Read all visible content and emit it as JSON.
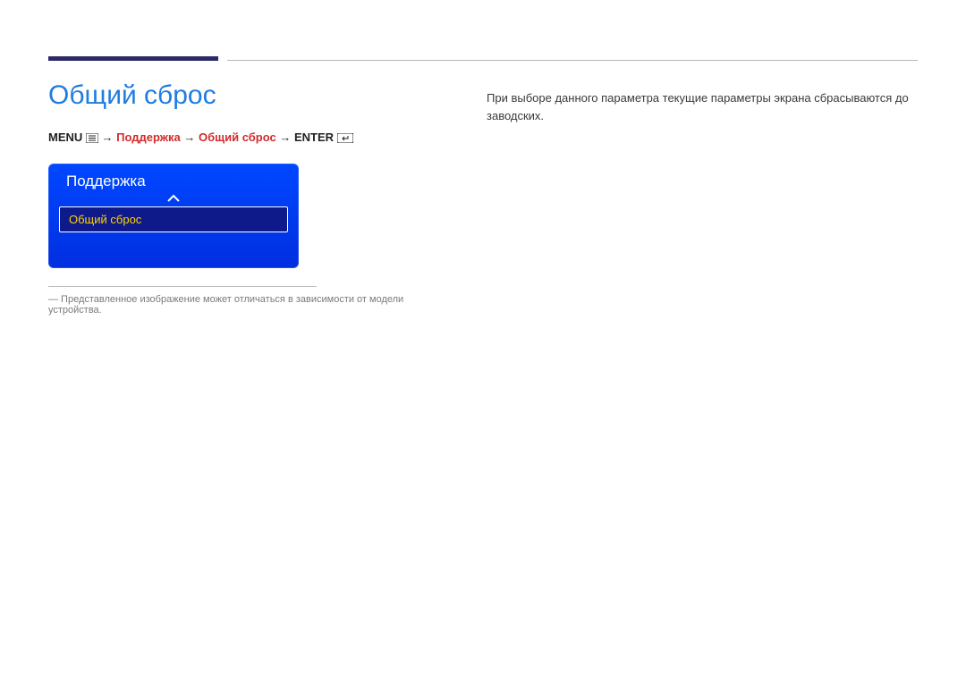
{
  "page": {
    "title": "Общий сброс",
    "breadcrumb": {
      "menu": "MENU",
      "arrow": "→",
      "support": "Поддержка",
      "reset": "Общий сброс",
      "enter": "ENTER"
    },
    "description": "При выборе данного параметра текущие параметры экрана сбрасываются до заводских."
  },
  "osd": {
    "title": "Поддержка",
    "item": "Общий сброс"
  },
  "footnote": "― Представленное изображение может отличаться в зависимости от модели устройства."
}
